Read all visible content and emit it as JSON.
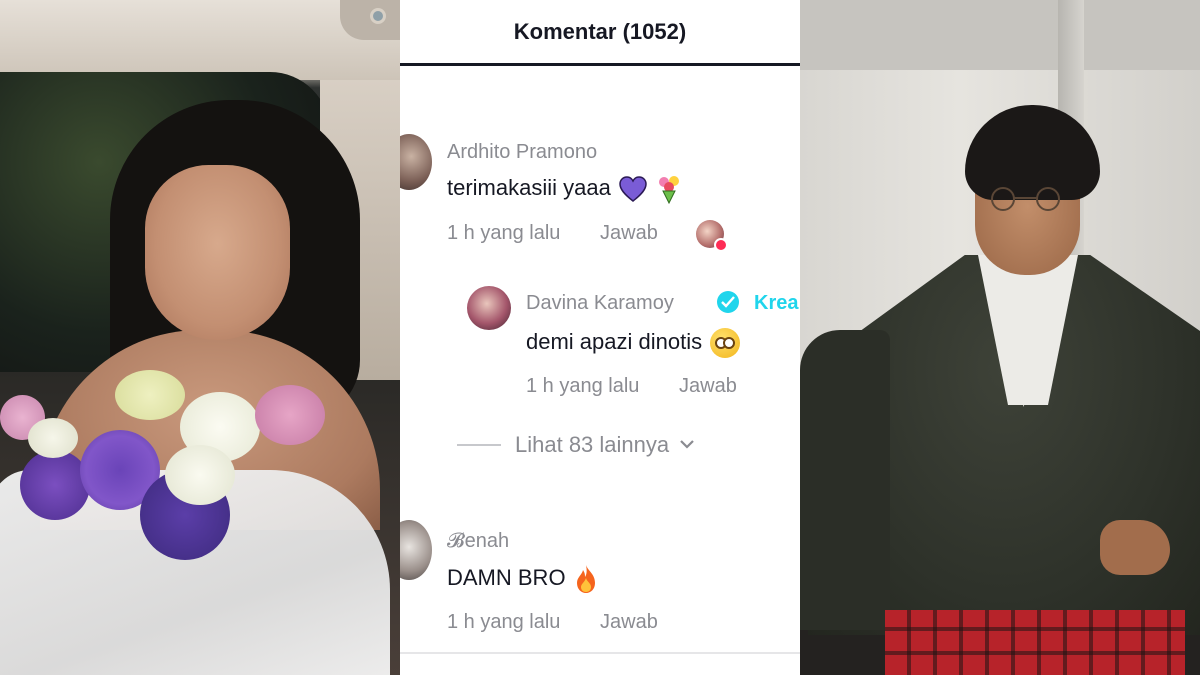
{
  "panel_title": "Komentar (1052)",
  "comments": [
    {
      "username": "Ardhito Pramono",
      "text": "terimakasiii yaaa",
      "emojis": [
        "purple-heart",
        "bouquet"
      ],
      "time": "1 h yang lalu",
      "reply_label": "Jawab",
      "liked_by_creator": true
    },
    {
      "username": "Davina Karamoy",
      "verified": true,
      "badge_label": "Krea",
      "text": "demi apazi dinotis",
      "emojis": [
        "flushed-face"
      ],
      "time": "1 h yang lalu",
      "reply_label": "Jawab",
      "is_reply": true
    },
    {
      "username": "𝓑enah",
      "text": "DAMN BRO",
      "emojis": [
        "fire"
      ],
      "time": "1 h yang lalu",
      "reply_label": "Jawab"
    }
  ],
  "more_replies": "Lihat 83 lainnya",
  "colors": {
    "text_primary": "#161823",
    "text_secondary": "#8a8b91",
    "verified": "#20d5ec",
    "like": "#fe2c55",
    "heart_emoji": "#7a5cd6"
  }
}
